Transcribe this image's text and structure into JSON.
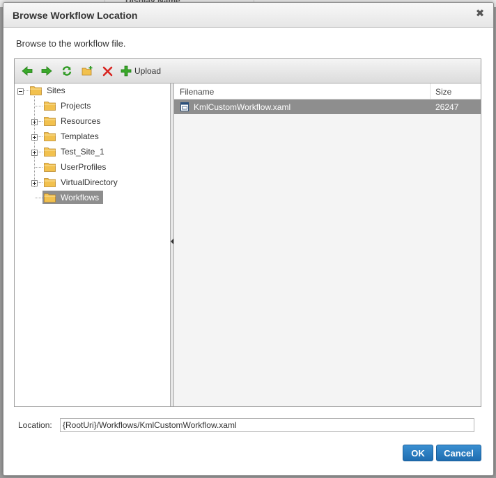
{
  "background_dialog": {
    "column_header": "Display Name"
  },
  "dialog": {
    "title": "Browse Workflow Location",
    "close_icon": "close-icon",
    "instruction": "Browse to the workflow file."
  },
  "toolbar": {
    "back_icon": "arrow-left-icon",
    "forward_icon": "arrow-right-icon",
    "refresh_icon": "refresh-icon",
    "new_folder_icon": "new-folder-icon",
    "delete_icon": "delete-icon",
    "upload_label": "Upload"
  },
  "tree": {
    "root": {
      "label": "Sites",
      "expanded": true
    },
    "children": [
      {
        "label": "Projects",
        "expandable": false,
        "selected": false
      },
      {
        "label": "Resources",
        "expandable": true,
        "selected": false
      },
      {
        "label": "Templates",
        "expandable": true,
        "selected": false
      },
      {
        "label": "Test_Site_1",
        "expandable": true,
        "selected": false
      },
      {
        "label": "UserProfiles",
        "expandable": false,
        "selected": false
      },
      {
        "label": "VirtualDirectory",
        "expandable": true,
        "selected": false
      },
      {
        "label": "Workflows",
        "expandable": false,
        "selected": true
      }
    ]
  },
  "files": {
    "columns": {
      "name": "Filename",
      "size": "Size"
    },
    "rows": [
      {
        "name": "KmlCustomWorkflow.xaml",
        "size": "26247",
        "selected": true
      }
    ]
  },
  "location": {
    "label": "Location:",
    "value": "{RootUri}/Workflows/KmlCustomWorkflow.xaml"
  },
  "buttons": {
    "ok": "OK",
    "cancel": "Cancel"
  },
  "colors": {
    "selection": "#8e8e8e",
    "primary_button": "#1f6db0",
    "folder": "#f2c14e"
  }
}
